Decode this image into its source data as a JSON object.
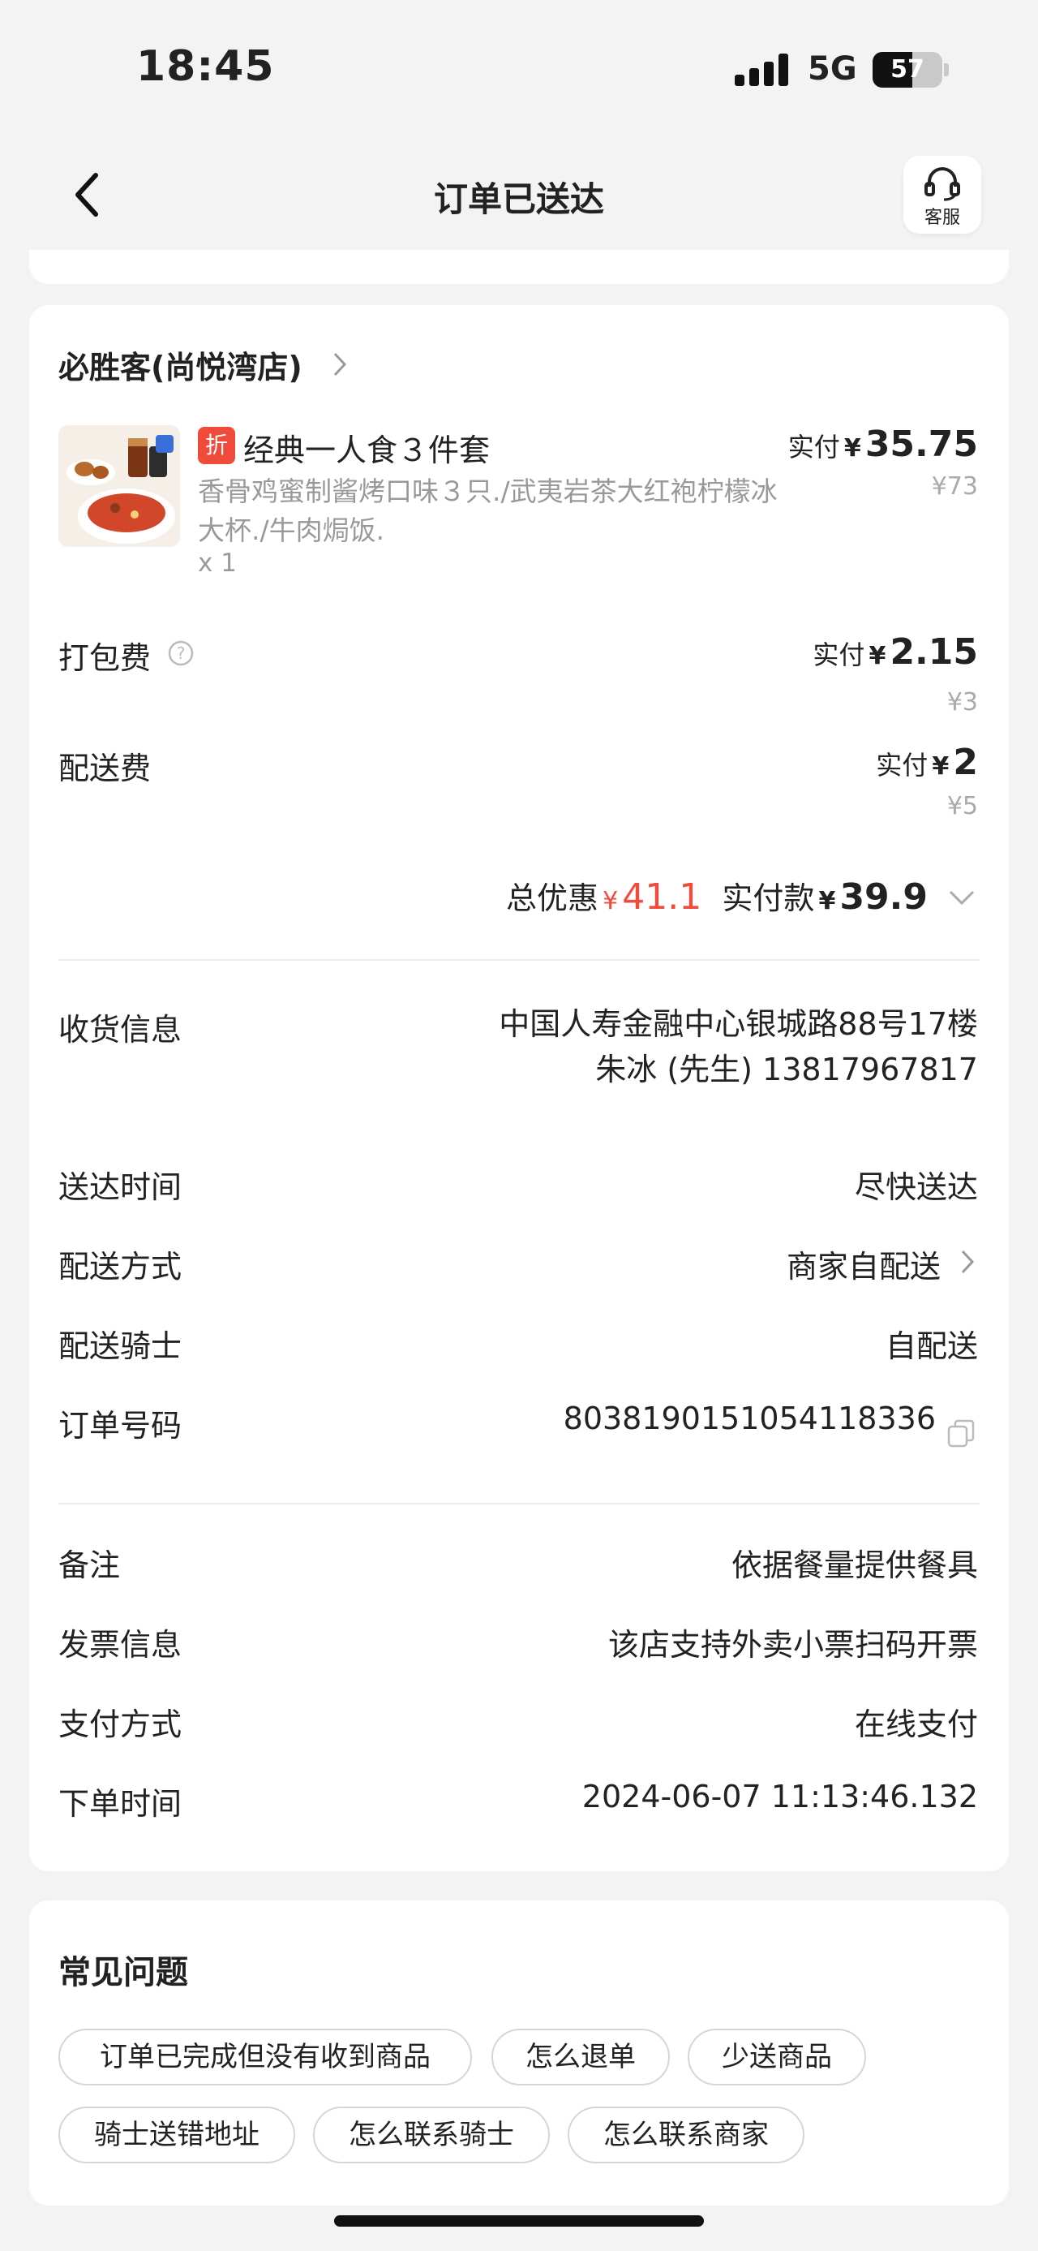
{
  "status_bar": {
    "time": "18:45",
    "network": "5G",
    "battery": "57",
    "battery_level": 0.57
  },
  "nav": {
    "back_icon": "chevron-left-icon",
    "title": "订单已送达",
    "service_icon": "headset-icon",
    "service_label": "客服"
  },
  "order": {
    "store_name": "必胜客(尚悦湾店)",
    "item": {
      "badge": "折",
      "name": "经典一人食３件套",
      "description": "香骨鸡蜜制酱烤口味３只./武夷岩茶大红袍柠檬冰大杯./牛肉焗饭.",
      "quantity": "x 1",
      "paid_label": "实付",
      "currency": "¥",
      "price": "35.75",
      "original_price": "¥73"
    },
    "packaging": {
      "label": "打包费",
      "paid_label": "实付",
      "currency": "¥",
      "price": "2.15",
      "original_price": "¥3"
    },
    "delivery_fee": {
      "label": "配送费",
      "paid_label": "实付",
      "currency": "¥",
      "price": "2",
      "original_price": "¥5"
    },
    "summary": {
      "discount_label": "总优惠",
      "discount_currency": "¥",
      "discount": "41.1",
      "paid_label": "实付款",
      "paid_currency": "¥",
      "paid": "39.9"
    }
  },
  "details": {
    "address_label": "收货信息",
    "address": "中国人寿金融中心银城路88号17楼",
    "recipient": "朱冰 (先生) 13817967817",
    "delivery_time_label": "送达时间",
    "delivery_time": "尽快送达",
    "delivery_method_label": "配送方式",
    "delivery_method": "商家自配送",
    "rider_label": "配送骑士",
    "rider": "自配送",
    "order_no_label": "订单号码",
    "order_no": "8038190151054118336",
    "remark_label": "备注",
    "remark": "依据餐量提供餐具",
    "invoice_label": "发票信息",
    "invoice": "该店支持外卖小票扫码开票",
    "payment_label": "支付方式",
    "payment": "在线支付",
    "order_time_label": "下单时间",
    "order_time": "2024-06-07 11:13:46.132"
  },
  "faq": {
    "title": "常见问题",
    "chips": [
      "订单已完成但没有收到商品",
      "怎么退单",
      "少送商品",
      "骑士送错地址",
      "怎么联系骑士",
      "怎么联系商家"
    ]
  },
  "colors": {
    "accent_red": "#f24b3c",
    "badge_red": "#f04a3a",
    "background": "#f3f3f3"
  }
}
